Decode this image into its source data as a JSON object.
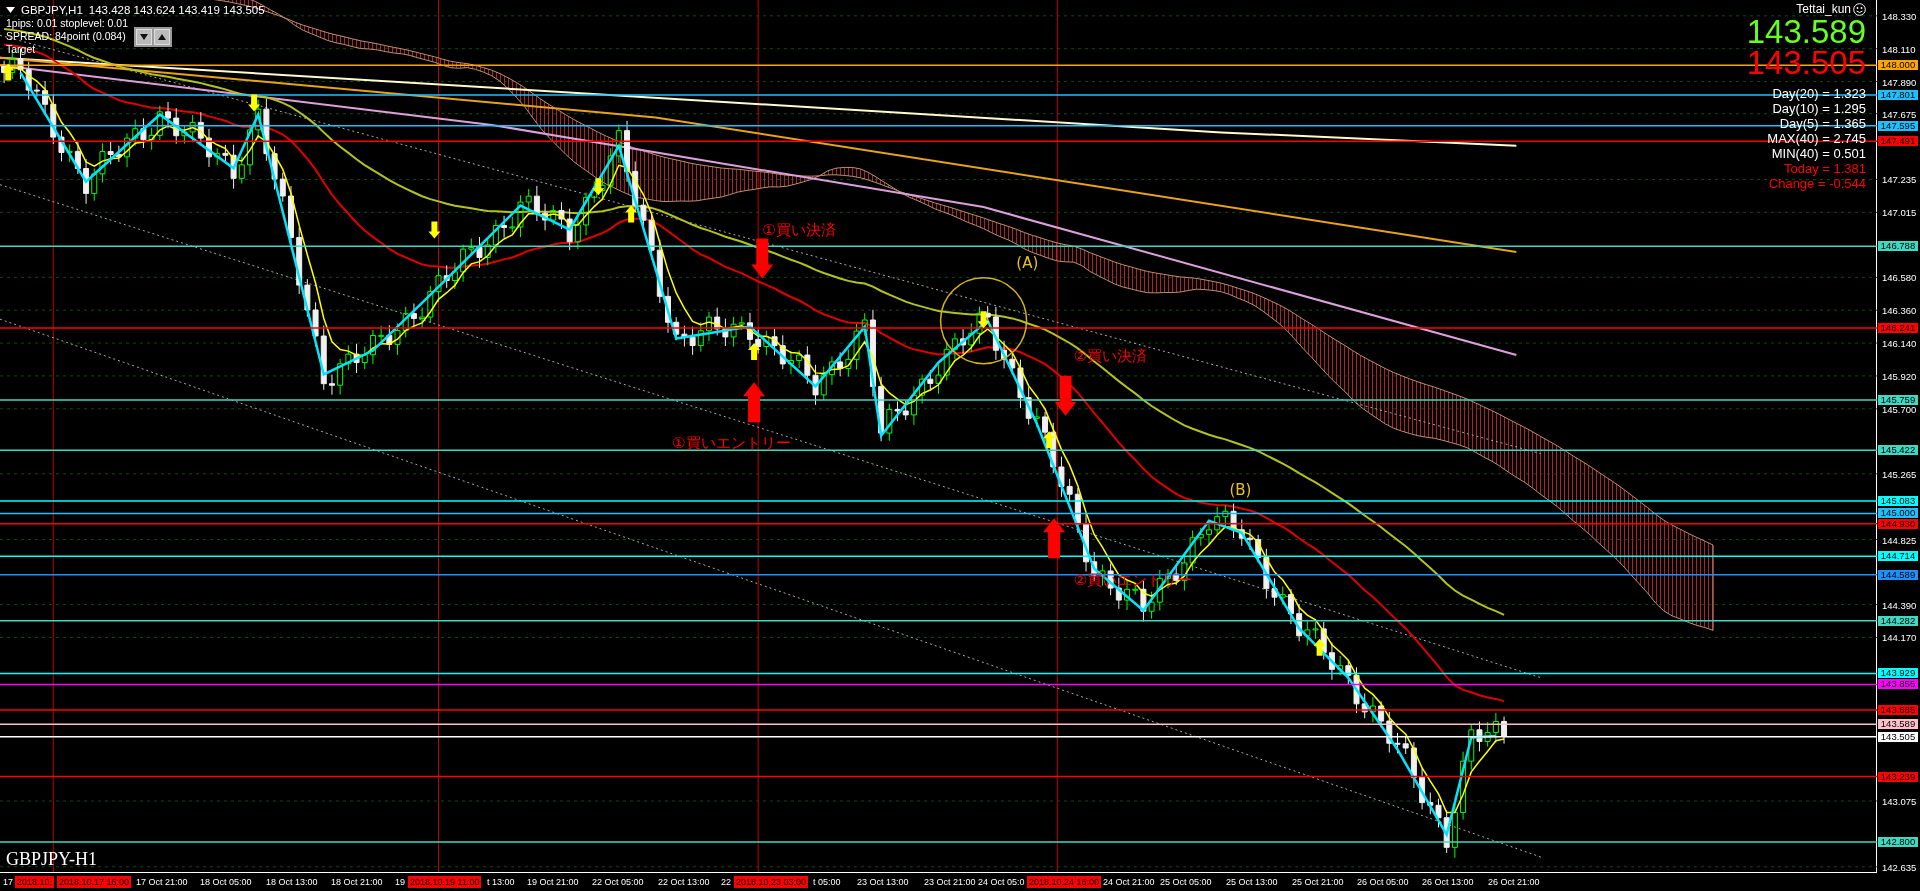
{
  "symbol_header": {
    "title": "GBPJPY,H1",
    "ohlc": "143.428 143.624 143.419 143.505",
    "info_lines": [
      "1pips: 0.01  stoplevel: 0.01",
      "SPREAD: 84point (0.084)",
      "Target"
    ]
  },
  "account_panel": {
    "user": "Tettai_kun",
    "ask": "143.589",
    "bid": "143.505",
    "stats": [
      {
        "text": "Day(20) = 1.323",
        "kind": "normal"
      },
      {
        "text": "Day(10) = 1.295",
        "kind": "normal"
      },
      {
        "text": "Day(5) = 1.365",
        "kind": "normal"
      },
      {
        "text": "MAX(40) = 2.745",
        "kind": "normal"
      },
      {
        "text": "MIN(40) = 0.501",
        "kind": "normal"
      },
      {
        "text": "Today = 1.381",
        "kind": "alert"
      },
      {
        "text": "Change = -0.544",
        "kind": "alert"
      }
    ]
  },
  "chart": {
    "markers": [
      {
        "kind": "exit_arrow",
        "color": "#ff0000"
      },
      {
        "kind": "label",
        "text": "①買い決済",
        "color": "#ff0000"
      },
      {
        "kind": "entry_arrow",
        "color": "#ff0000"
      },
      {
        "kind": "label",
        "text": "①買いエントリー",
        "color": "#ff0000"
      },
      {
        "kind": "circle",
        "color": "#d4b21c"
      },
      {
        "kind": "label",
        "text": "(A)",
        "color": "#e8c21c"
      },
      {
        "kind": "exit_arrow",
        "color": "#ff0000"
      },
      {
        "kind": "label",
        "text": "②買い決済",
        "color": "#ff0000"
      },
      {
        "kind": "entry_arrow",
        "color": "#ff0000"
      },
      {
        "kind": "label",
        "text": "②買いエントリー",
        "color": "#ff0000"
      },
      {
        "kind": "label",
        "text": "(B)",
        "color": "#e8c21c"
      },
      {
        "kind": "signal_down",
        "color": "#ffff00"
      },
      {
        "kind": "signal_down",
        "color": "#ffff00"
      },
      {
        "kind": "signal_down",
        "color": "#ffff00"
      },
      {
        "kind": "signal_up",
        "color": "#ffff00"
      },
      {
        "kind": "signal_up",
        "color": "#ffff00"
      },
      {
        "kind": "signal_down",
        "color": "#ffff00"
      },
      {
        "kind": "signal_up",
        "color": "#ffff00"
      },
      {
        "kind": "signal_up",
        "color": "#ffff00"
      },
      {
        "kind": "signal_up",
        "color": "#ffff00"
      }
    ],
    "price_levels": [
      {
        "label": "148.000",
        "color": "#ffa500"
      },
      {
        "label": "147.801",
        "color": "#1ec0ff"
      },
      {
        "label": "147.595",
        "color": "#1ec0ff"
      },
      {
        "label": "147.491",
        "color": "#ff0000"
      },
      {
        "label": "146.788",
        "color": "#40d8c0"
      },
      {
        "label": "146.241",
        "color": "#ff0000"
      },
      {
        "label": "145.759",
        "color": "#40d8c0"
      },
      {
        "label": "145.422",
        "color": "#40d8c0"
      },
      {
        "label": "145.083",
        "color": "#00ffff"
      },
      {
        "label": "145.000",
        "color": "#1ec0ff"
      },
      {
        "label": "144.930",
        "color": "#ff0000"
      },
      {
        "label": "144.714",
        "color": "#00ffff"
      },
      {
        "label": "144.589",
        "color": "#1e90ff"
      },
      {
        "label": "144.282",
        "color": "#40d8c0"
      },
      {
        "label": "143.929",
        "color": "#00ffff"
      },
      {
        "label": "143.855",
        "color": "#ff00ff"
      },
      {
        "label": "143.685",
        "color": "#ff0000"
      },
      {
        "label": "143.589",
        "color": "#ffc0cb"
      },
      {
        "label": "143.505",
        "color": "#ffffff"
      },
      {
        "label": "143.239",
        "color": "#ff0000"
      },
      {
        "label": "142.800",
        "color": "#40d8c0"
      }
    ]
  },
  "price_axis": [
    "148.330",
    "148.110",
    "147.890",
    "147.675",
    "147.235",
    "147.015",
    "146.580",
    "146.360",
    "146.140",
    "145.920",
    "145.700",
    "145.265",
    "144.825",
    "144.390",
    "144.170",
    "143.075",
    "142.635"
  ],
  "chart_label": "GBPJPY-H1",
  "time_axis": [
    {
      "text": "17",
      "kind": "time"
    },
    {
      "text": "2018.10.",
      "kind": "marker"
    },
    {
      "text": "2018.10.17 16:00",
      "kind": "marker"
    },
    {
      "text": "17 Oct 21:00",
      "kind": "time"
    },
    {
      "text": "18 Oct 05:00",
      "kind": "time"
    },
    {
      "text": "18 Oct 13:00",
      "kind": "time"
    },
    {
      "text": "18 Oct 21:00",
      "kind": "time"
    },
    {
      "text": "19",
      "kind": "time"
    },
    {
      "text": "2018.10.19 11:00",
      "kind": "marker"
    },
    {
      "text": "t 13:00",
      "kind": "time"
    },
    {
      "text": "19 Oct 21:00",
      "kind": "time"
    },
    {
      "text": "22 Oct 05:00",
      "kind": "time"
    },
    {
      "text": "22 Oct 13:00",
      "kind": "time"
    },
    {
      "text": "22",
      "kind": "time"
    },
    {
      "text": "2018.10.23 03:00",
      "kind": "marker"
    },
    {
      "text": "t 05:00",
      "kind": "time"
    },
    {
      "text": "23 Oct 13:00",
      "kind": "time"
    },
    {
      "text": "23 Oct 21:00",
      "kind": "time"
    },
    {
      "text": "24 Oct 05:0",
      "kind": "time"
    },
    {
      "text": "2018.10.24 16:00",
      "kind": "marker"
    },
    {
      "text": "24 Oct 21:00",
      "kind": "time"
    },
    {
      "text": "25 Oct 05:00",
      "kind": "time"
    },
    {
      "text": "25 Oct 13:00",
      "kind": "time"
    },
    {
      "text": "25 Oct 21:00",
      "kind": "time"
    },
    {
      "text": "26 Oct 05:00",
      "kind": "time"
    },
    {
      "text": "26 Oct 13:00",
      "kind": "time"
    },
    {
      "text": "26 Oct 21:00",
      "kind": "time"
    }
  ]
}
